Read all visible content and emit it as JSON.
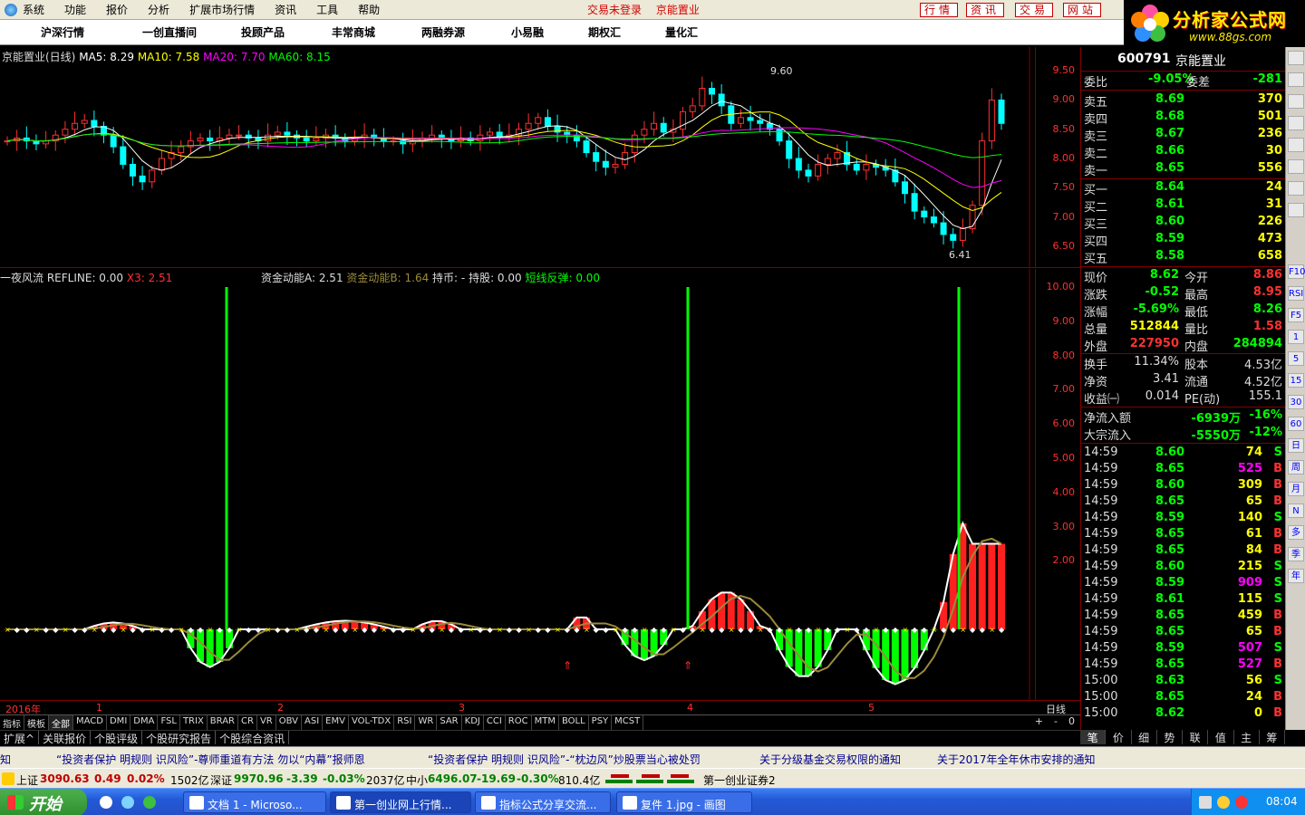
{
  "menu": {
    "items": [
      "系统",
      "功能",
      "报价",
      "分析",
      "扩展市场行情",
      "资讯",
      "工具",
      "帮助"
    ],
    "status_login": "交易未登录",
    "status_stock": "京能置业",
    "right_buttons": [
      "行情",
      "资讯",
      "交易",
      "网站"
    ]
  },
  "toolbar": [
    "沪深行情",
    "一创直播间",
    "投顾产品",
    "丰常商城",
    "两融券源",
    "小易融",
    "期权汇",
    "量化汇"
  ],
  "brand": {
    "name": "分析家公式网",
    "url": "www.88gs.com"
  },
  "kline": {
    "title": "京能置业(日线)",
    "ma5_label": "MA5: 8.29",
    "ma10_label": "MA10: 7.58",
    "ma20_label": "MA20: 7.70",
    "ma60_label": "MA60: 8.15",
    "high_label": "9.60",
    "low_label": "6.41",
    "yticks": [
      "9.50",
      "9.00",
      "8.50",
      "8.00",
      "7.50",
      "7.00",
      "6.50"
    ],
    "yvals": [
      9.5,
      9.0,
      8.5,
      8.0,
      7.5,
      7.0,
      6.5
    ],
    "colors": {
      "ma5": "#ffffff",
      "ma10": "#ffff00",
      "ma20": "#ff00ff",
      "ma60": "#00ff00",
      "up": "#ff3030",
      "down": "#00ffff"
    }
  },
  "indicator": {
    "name": "一夜风流",
    "refline": "REFLINE: 0.00",
    "x3": "X3: 2.51",
    "zjA": "资金动能A: 2.51",
    "zjB": "资金动能B: 1.64",
    "chibi": "持币: -",
    "chigu": "持股: 0.00",
    "duanxian": "短线反弹: 0.00",
    "yticks": [
      "10.00",
      "9.00",
      "8.00",
      "7.00",
      "6.00",
      "5.00",
      "4.00",
      "3.00",
      "2.00"
    ],
    "yvals": [
      10,
      9,
      8,
      7,
      6,
      5,
      4,
      3,
      2
    ]
  },
  "xaxis": {
    "year": "2016年",
    "months": [
      "1",
      "2",
      "3",
      "4",
      "5"
    ],
    "period": "日线"
  },
  "tabs": [
    "指标",
    "模板",
    "全部",
    "MACD",
    "DMI",
    "DMA",
    "FSL",
    "TRIX",
    "BRAR",
    "CR",
    "VR",
    "OBV",
    "ASI",
    "EMV",
    "VOL-TDX",
    "RSI",
    "WR",
    "SAR",
    "KDJ",
    "CCI",
    "ROC",
    "MTM",
    "BOLL",
    "PSY",
    "MCST"
  ],
  "tab_controls": [
    "+",
    "-",
    "0"
  ],
  "subtabs": [
    "扩展^",
    "关联报价",
    "个股评级",
    "个股研究报告",
    "个股综合资讯"
  ],
  "quote": {
    "code": "600791",
    "name": "京能置业",
    "weibi_label": "委比",
    "weibi": "-9.05%",
    "weicha_label": "委差",
    "weicha": "-281",
    "sells": [
      {
        "label": "卖五",
        "price": "8.69",
        "vol": "370"
      },
      {
        "label": "卖四",
        "price": "8.68",
        "vol": "501"
      },
      {
        "label": "卖三",
        "price": "8.67",
        "vol": "236"
      },
      {
        "label": "卖二",
        "price": "8.66",
        "vol": "30"
      },
      {
        "label": "卖一",
        "price": "8.65",
        "vol": "556"
      }
    ],
    "buys": [
      {
        "label": "买一",
        "price": "8.64",
        "vol": "24"
      },
      {
        "label": "买二",
        "price": "8.61",
        "vol": "31"
      },
      {
        "label": "买三",
        "price": "8.60",
        "vol": "226"
      },
      {
        "label": "买四",
        "price": "8.59",
        "vol": "473"
      },
      {
        "label": "买五",
        "price": "8.58",
        "vol": "658"
      }
    ],
    "stats": [
      {
        "l1": "现价",
        "v1": "8.62",
        "c1": "#00ff00",
        "l2": "今开",
        "v2": "8.86",
        "c2": "#ff3030"
      },
      {
        "l1": "涨跌",
        "v1": "-0.52",
        "c1": "#00ff00",
        "l2": "最高",
        "v2": "8.95",
        "c2": "#ff3030"
      },
      {
        "l1": "涨幅",
        "v1": "-5.69%",
        "c1": "#00ff00",
        "l2": "最低",
        "v2": "8.26",
        "c2": "#00ff00"
      },
      {
        "l1": "总量",
        "v1": "512844",
        "c1": "#ffff00",
        "l2": "量比",
        "v2": "1.58",
        "c2": "#ff3030"
      },
      {
        "l1": "外盘",
        "v1": "227950",
        "c1": "#ff3030",
        "l2": "内盘",
        "v2": "284894",
        "c2": "#00ff00"
      }
    ],
    "stats2": [
      {
        "l1": "换手",
        "v1": "11.34%",
        "l2": "股本",
        "v2": "4.53亿"
      },
      {
        "l1": "净资",
        "v1": "3.41",
        "l2": "流通",
        "v2": "4.52亿"
      },
      {
        "l1": "收益㈠",
        "v1": "0.014",
        "l2": "PE(动)",
        "v2": "155.1"
      }
    ],
    "flows": [
      {
        "label": "净流入额",
        "val": "-6939万",
        "pct": "-16%"
      },
      {
        "label": "大宗流入",
        "val": "-5550万",
        "pct": "-12%"
      }
    ],
    "ticks": [
      {
        "t": "14:59",
        "p": "8.60",
        "v": "74",
        "s": "S",
        "pc": "#00ff00",
        "vc": "#ffff00"
      },
      {
        "t": "14:59",
        "p": "8.65",
        "v": "525",
        "s": "B",
        "pc": "#00ff00",
        "vc": "#ff00ff"
      },
      {
        "t": "14:59",
        "p": "8.60",
        "v": "309",
        "s": "B",
        "pc": "#00ff00",
        "vc": "#ffff00"
      },
      {
        "t": "14:59",
        "p": "8.65",
        "v": "65",
        "s": "B",
        "pc": "#00ff00",
        "vc": "#ffff00"
      },
      {
        "t": "14:59",
        "p": "8.59",
        "v": "140",
        "s": "S",
        "pc": "#00ff00",
        "vc": "#ffff00"
      },
      {
        "t": "14:59",
        "p": "8.65",
        "v": "61",
        "s": "B",
        "pc": "#00ff00",
        "vc": "#ffff00"
      },
      {
        "t": "14:59",
        "p": "8.65",
        "v": "84",
        "s": "B",
        "pc": "#00ff00",
        "vc": "#ffff00"
      },
      {
        "t": "14:59",
        "p": "8.60",
        "v": "215",
        "s": "S",
        "pc": "#00ff00",
        "vc": "#ffff00"
      },
      {
        "t": "14:59",
        "p": "8.59",
        "v": "909",
        "s": "S",
        "pc": "#00ff00",
        "vc": "#ff00ff"
      },
      {
        "t": "14:59",
        "p": "8.61",
        "v": "115",
        "s": "S",
        "pc": "#00ff00",
        "vc": "#ffff00"
      },
      {
        "t": "14:59",
        "p": "8.65",
        "v": "459",
        "s": "B",
        "pc": "#00ff00",
        "vc": "#ffff00"
      },
      {
        "t": "14:59",
        "p": "8.65",
        "v": "65",
        "s": "B",
        "pc": "#00ff00",
        "vc": "#ffff00"
      },
      {
        "t": "14:59",
        "p": "8.59",
        "v": "507",
        "s": "S",
        "pc": "#00ff00",
        "vc": "#ff00ff"
      },
      {
        "t": "14:59",
        "p": "8.65",
        "v": "527",
        "s": "B",
        "pc": "#00ff00",
        "vc": "#ff00ff"
      },
      {
        "t": "15:00",
        "p": "8.63",
        "v": "56",
        "s": "S",
        "pc": "#00ff00",
        "vc": "#ffff00"
      },
      {
        "t": "15:00",
        "p": "8.65",
        "v": "24",
        "s": "B",
        "pc": "#00ff00",
        "vc": "#ffff00"
      },
      {
        "t": "15:00",
        "p": "8.62",
        "v": "0",
        "s": "B",
        "pc": "#00ff00",
        "vc": "#ffff00"
      }
    ]
  },
  "bottomtabs": [
    "笔",
    "价",
    "细",
    "势",
    "联",
    "值",
    "主",
    "筹"
  ],
  "rtools": [
    "F10",
    "RSI",
    "F5",
    "1",
    "5",
    "15",
    "30",
    "60",
    "日",
    "周",
    "月",
    "N",
    "多",
    "季",
    "年"
  ],
  "news": [
    "知",
    "“投资者保护 明规则 识风险”-尊师重道有方法 勿以“内幕”报师恩",
    "“投资者保护 明规则 识风险”-“枕边风”炒股票当心被处罚",
    "关于分级基金交易权限的通知",
    "关于2017年全年休市安排的通知"
  ],
  "indexbar": {
    "sh_name": "上证",
    "sh_val": "3090.63",
    "sh_chg": "0.49",
    "sh_pct": "0.02%",
    "sh_amt": "1502亿",
    "sz_name": "深证",
    "sz_val": "9970.96",
    "sz_chg": "-3.39",
    "sz_pct": "-0.03%",
    "sz_amt": "2037亿",
    "zx_name": "中小",
    "zx_val": "6496.07",
    "zx_chg": "-19.69",
    "zx_pct": "-0.30%",
    "zx_amt": "810.4亿",
    "broker": "第一创业证券2"
  },
  "taskbar": {
    "start": "开始",
    "tasks": [
      "文档 1 - Microso...",
      "第一创业网上行情...",
      "指标公式分享交流...",
      "复件 1.jpg - 画图"
    ],
    "clock": "08:04"
  }
}
